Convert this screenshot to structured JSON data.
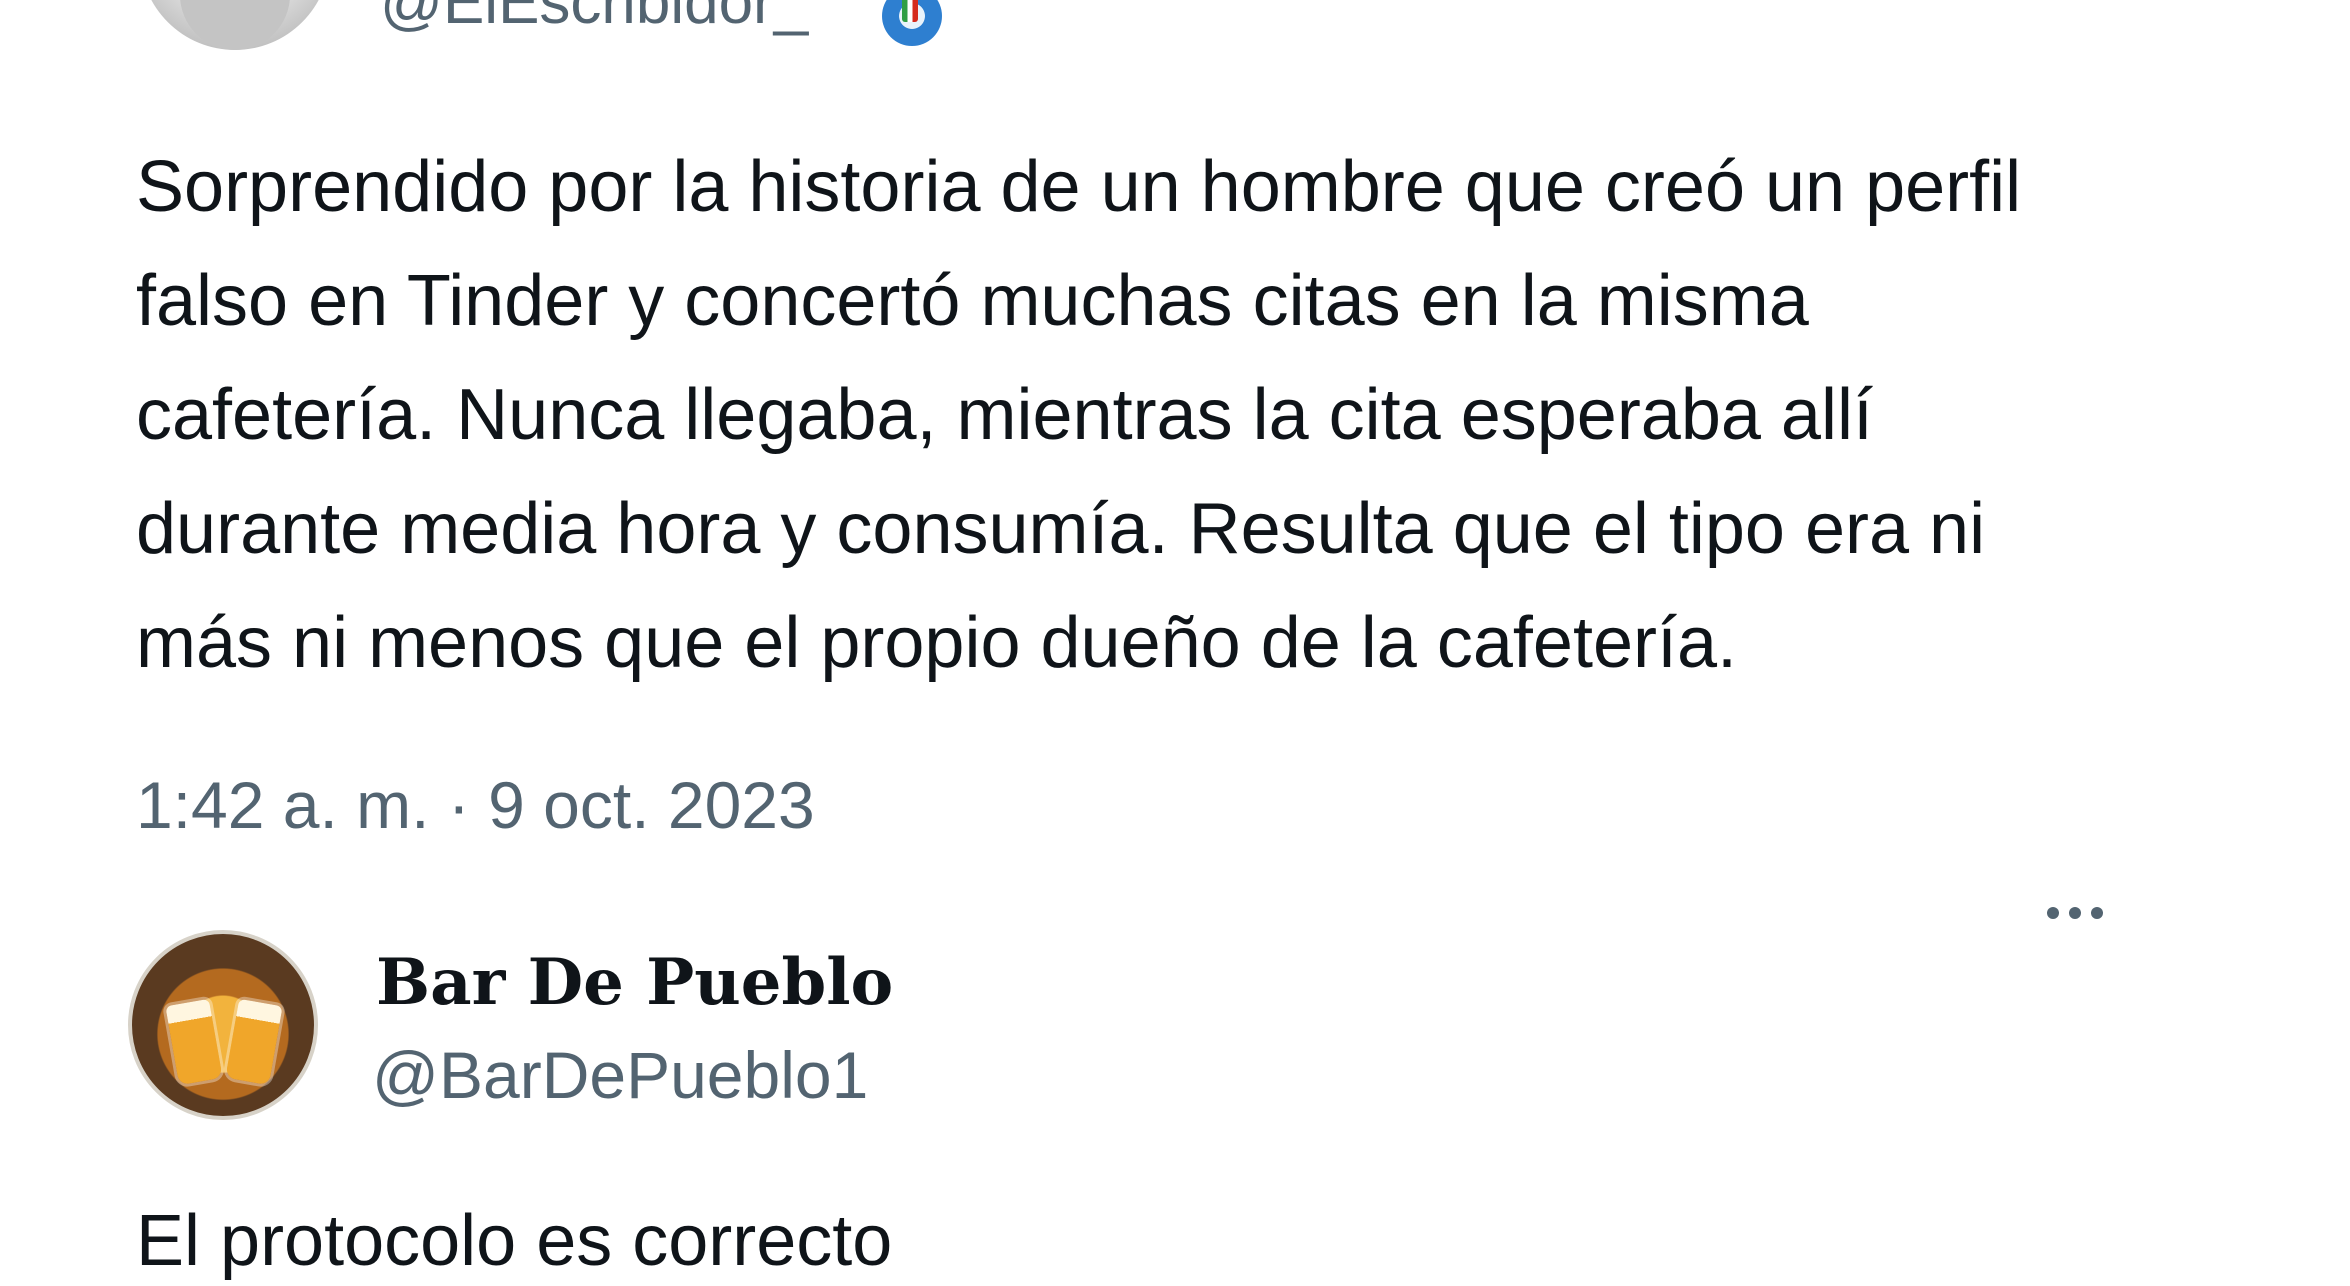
{
  "original_tweet": {
    "handle": "@ElEscribidor_",
    "flag_icon": "italian-flag-globe-icon",
    "text_lines": [
      "Sorprendido por la historia de un hombre que creó un perfil",
      "falso en Tinder y concertó muchas citas en la misma",
      "cafetería. Nunca llegaba, mientras la cita esperaba allí",
      "durante media hora y consumía. Resulta que el tipo era ni",
      "más ni menos que el propio dueño de la cafetería."
    ],
    "timestamp": "1:42 a. m. · 9 oct. 2023"
  },
  "reply": {
    "display_name": "Bar De Pueblo",
    "handle": "@BarDePueblo1",
    "more_icon": "ellipsis-icon",
    "text": "El protocolo es correcto"
  },
  "colors": {
    "text_primary": "#0f1419",
    "text_secondary": "#536471",
    "background": "#ffffff"
  }
}
